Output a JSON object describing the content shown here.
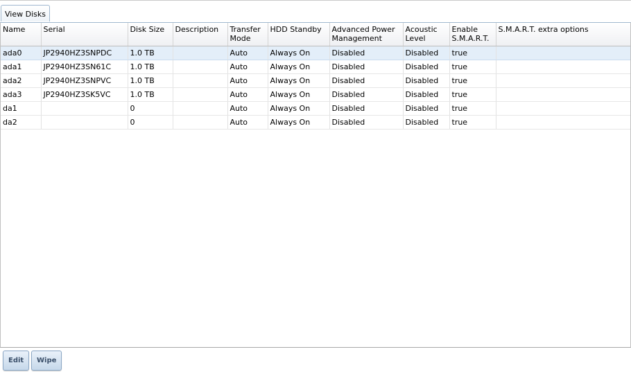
{
  "tabs": [
    {
      "label": "View Disks"
    }
  ],
  "table": {
    "columns": [
      "Name",
      "Serial",
      "Disk Size",
      "Description",
      "Transfer Mode",
      "HDD Standby",
      "Advanced Power Management",
      "Acoustic Level",
      "Enable S.M.A.R.T.",
      "S.M.A.R.T. extra options"
    ],
    "rows": [
      [
        "ada0",
        "JP2940HZ3SNPDC",
        "1.0 TB",
        "",
        "Auto",
        "Always On",
        "Disabled",
        "Disabled",
        "true",
        ""
      ],
      [
        "ada1",
        "JP2940HZ3SN61C",
        "1.0 TB",
        "",
        "Auto",
        "Always On",
        "Disabled",
        "Disabled",
        "true",
        ""
      ],
      [
        "ada2",
        "JP2940HZ3SNPVC",
        "1.0 TB",
        "",
        "Auto",
        "Always On",
        "Disabled",
        "Disabled",
        "true",
        ""
      ],
      [
        "ada3",
        "JP2940HZ3SK5VC",
        "1.0 TB",
        "",
        "Auto",
        "Always On",
        "Disabled",
        "Disabled",
        "true",
        ""
      ],
      [
        "da1",
        "",
        "0",
        "",
        "Auto",
        "Always On",
        "Disabled",
        "Disabled",
        "true",
        ""
      ],
      [
        "da2",
        "",
        "0",
        "",
        "Auto",
        "Always On",
        "Disabled",
        "Disabled",
        "true",
        ""
      ]
    ],
    "selected_row": 0
  },
  "buttons": {
    "edit": "Edit",
    "wipe": "Wipe"
  },
  "colors": {
    "selection": "#e3eef9",
    "button_text": "#3a4f6a",
    "tab_border": "#9fb7cf"
  }
}
